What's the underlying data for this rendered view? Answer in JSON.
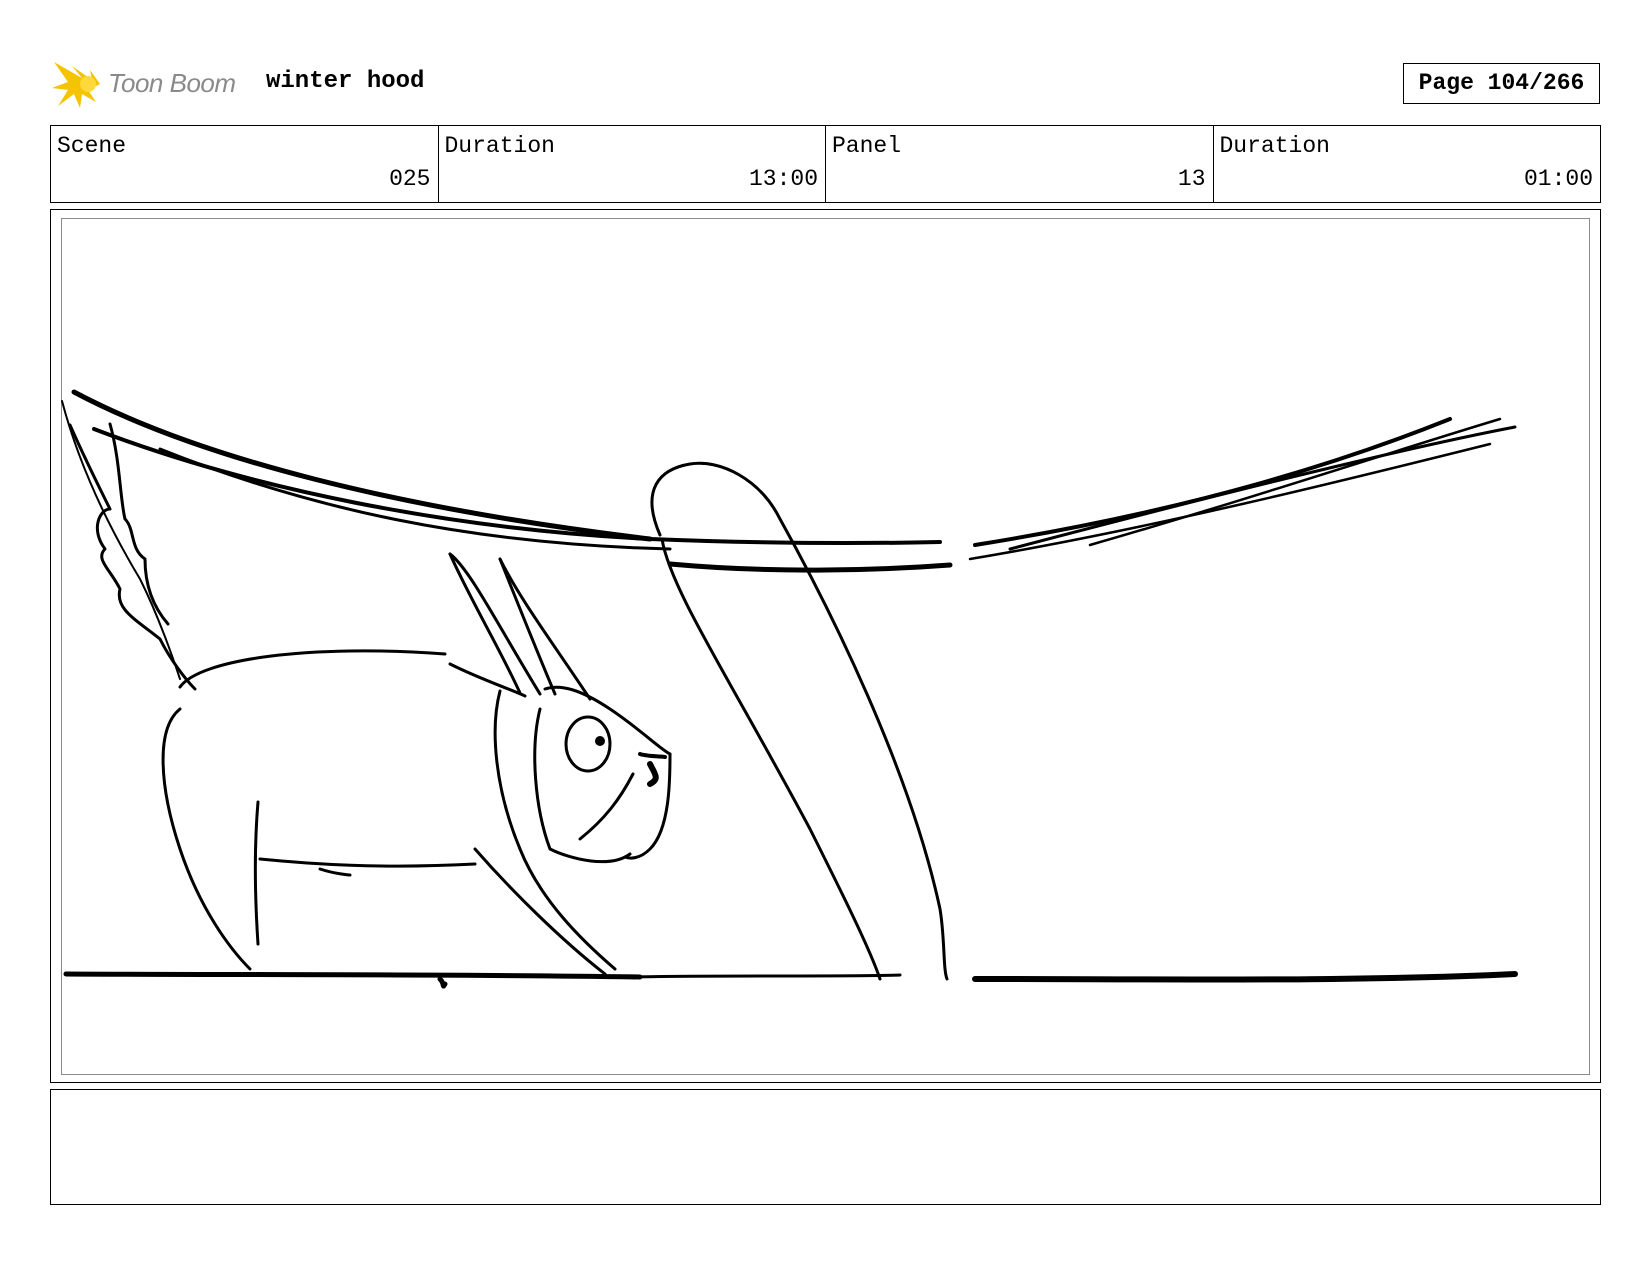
{
  "header": {
    "logo_text": "Toon Boom",
    "project_title": "winter hood",
    "page_label": "Page 104/266"
  },
  "info": {
    "scene_label": "Scene",
    "scene_value": "025",
    "scene_duration_label": "Duration",
    "scene_duration_value": "13:00",
    "panel_label": "Panel",
    "panel_value": "13",
    "panel_duration_label": "Duration",
    "panel_duration_value": "01:00"
  },
  "panel": {
    "image_icon": "storyboard-sketch-squirrel-icon"
  },
  "notes": {
    "text": ""
  },
  "colors": {
    "logo_yellow": "#f5c400",
    "logo_text_gray": "#8a8a8a",
    "inner_frame_gray": "#8a8a8a"
  }
}
